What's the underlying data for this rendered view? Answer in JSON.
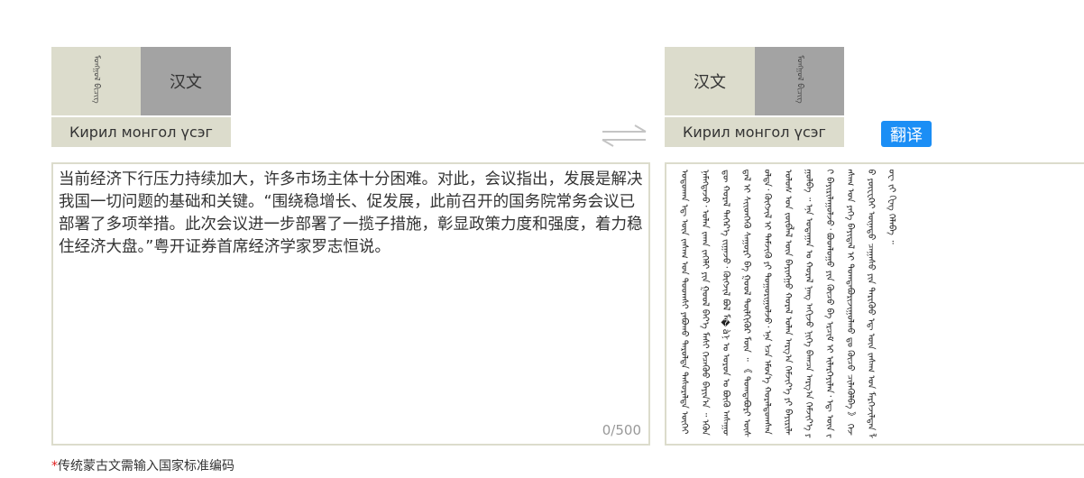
{
  "left_panel": {
    "tabs": {
      "traditional_mongolian": "ᠮᠣᠩᠭᠣᠯ ᠪᠢᠴᠢᠭ",
      "chinese": "汉文",
      "cyrillic": "Кирил монгол үсэг"
    },
    "input": {
      "value": "当前经济下行压力持续加大，许多市场主体十分困难。对此，会议指出，发展是解决我国一切问题的基础和关键。“围绕稳增长、促发展，此前召开的国务院常务会议已部署了多项举措。此次会议进一步部署了一揽子措施，彰显政策力度和强度，着力稳住经济大盘。”粤开证券首席经济学家罗志恒说。",
      "counter": "0/500"
    }
  },
  "right_panel": {
    "tabs": {
      "chinese": "汉文",
      "traditional_mongolian": "ᠮᠣᠩᠭᠣᠯ ᠪᠢᠴᠢᠭ",
      "cyrillic": "Кирил монгол үсэг"
    },
    "translate_label": "翻译",
    "output": "ᠣᠳᠣᠬᠠᠨ ᠡᠳ᠋ ᠦᠨ ᠵᠠᠰᠠᠭ ᠤᠨ ᠳᠣᠣᠭᠰᠢ ᠶᠠᠪᠤᠬᠤ ᠳᠠᠷᠤᠯᠲᠠ ᠲᠠᠰᠤᠷᠠᠯᠲᠠ ᠦᠭᠡᠢ ᠨᠡᠮᠡᠭᠳᠡᠵᠦ᠂ ᠣᠯᠠᠨ ᠵᠠᠬᠠ ᠵᠡᠭᠡᠯᠢ ᠶᠢᠨ ᠭᠣᠣᠯ ᠪᠡᠶ᠎ᠡ ᠮᠠᠰᠢ ᠬᠡᠴᠡᠭᠦᠦ ᠪᠠᠶᠢᠨ᠎ᠠ ᠃ ᠡᠭᠦᠨ ᠳᠦ ᠬᠤᠷᠠᠯ ᠳᠡᠭᠡᠷ᠎ᠡ ᠵᠢᠭᠠᠵᠤ᠂ ᠬᠥᠭᠵᠢᠯ ᠪᠣᠯ ᠮ�àᠨ ᠤ ᠣᠷᠣᠨ ᠤ ᠪᠦᠬᠦ ᠠᠰᠠᠭᠤᠳᠠᠯ ᠢ ᠰᠢᠢᠳᠬᠡᠬᠦ ᠰᠠᠭᠤᠷᠢ ᠪᠠ ᠭᠣᠣᠯ ᠲᠦᠯᠬᠢᠭᠦᠷ ᠮᠥᠨ ᠃ 《 ᠲᠣᠭᠲᠠᠪᠤᠷᠢ ᠥᠰᠦᠯᠲᠡ᠂ ᠬᠥᠭᠵᠢᠯ ᠢ ᠳᠡᠮᠵᠢᠬᠦ ᠶᠢ ᠲᠣᠭᠣᠷᠢᠭᠤᠯᠵᠤ᠂ ᠡᠨᠡ ᠡᠴᠡ ᠡᠮᠦᠨ᠎ᠡ ᠬᠤᠷᠠᠯᠳᠤᠭᠰᠠᠨ ᠤᠯᠤᠰ ᠤᠨ ᠵᠥᠪᠯᠡᠯ ᠦᠨ ᠪᠠᠶᠢᠩᠭᠤ ᠬᠤᠷᠠᠯ ᠣᠯᠠᠨ ᠠᠷᠭ᠎ᠠ ᠬᠡᠮᠵᠢᠶ᠎ᠡ ᠶᠢ ᠪᠠᠶᠢᠷᠢᠯᠠᠭᠤᠯᠪᠠ ᠃ ᠡᠨᠡ ᠤᠳᠠᠭᠠᠨ ᠤ ᠬᠤᠷᠠᠯ ᠨᠡᠩ ᠠᠬᠢᠵᠤ ᠨᠢᠭᠡ ᠪᠠᠭᠴᠠ ᠠᠷᠭ᠎ᠠ ᠬᠡᠮᠵᠢᠶ᠎ᠡ ᠶᠢ ᠪᠠᠶᠢᠷᠢᠯᠠᠭᠤᠯᠵᠤ᠂ ᠪᠣᠳᠯᠣᠭᠣ ᠶᠢᠨ ᠬᠦᠴᠦ ᠪᠠ ᠡᠷᠴᠢᠮ ᠢ ᠢᠯᠡᠷᠬᠡᠶᠢᠯᠡᠨ᠂ ᠡᠳ᠋ ᠦᠨ ᠵᠠᠰᠠᠭ ᠤᠨ ᠶᠡᠬᠡ ᠪᠠᠶᠢᠳᠠᠯ ᠢ ᠲᠣᠭᠲᠠᠪᠤᠷᠢᠵᠢᠭᠤᠯᠬᠤ ᠳᠤ ᠬᠦᠴᠦ ᠴᠢᠯᠡᠭᠦᠯᠪᠡ 》 ᠭᠡᠵᠦ ᠶᠦᠸᠸᠺᠠᠢ ᠦᠨᠡᠲᠦ ᠴᠠᠭᠠᠰᠤ ᠶᠢᠨ ᠲᠡᠷᠢᠭᠦᠦ ᠡᠳ᠋ ᠦᠨ ᠵᠠᠰᠠᠭ ᠤᠨ ᠮᠡᠷᠭᠡᠵᠢᠯᠲᠡᠨ ᠯᠦᠸ ᠵᠢ ᠬᠧᠩ ᠬᠡᠯᠡᠪᠡ ᠃"
  },
  "note": {
    "star": "*",
    "text": "传统蒙古文需输入国家标准编码"
  },
  "colors": {
    "tab_light": "#dcdccc",
    "tab_active": "#a3a3a3",
    "button": "#1b8ef5",
    "required": "#e02020"
  }
}
